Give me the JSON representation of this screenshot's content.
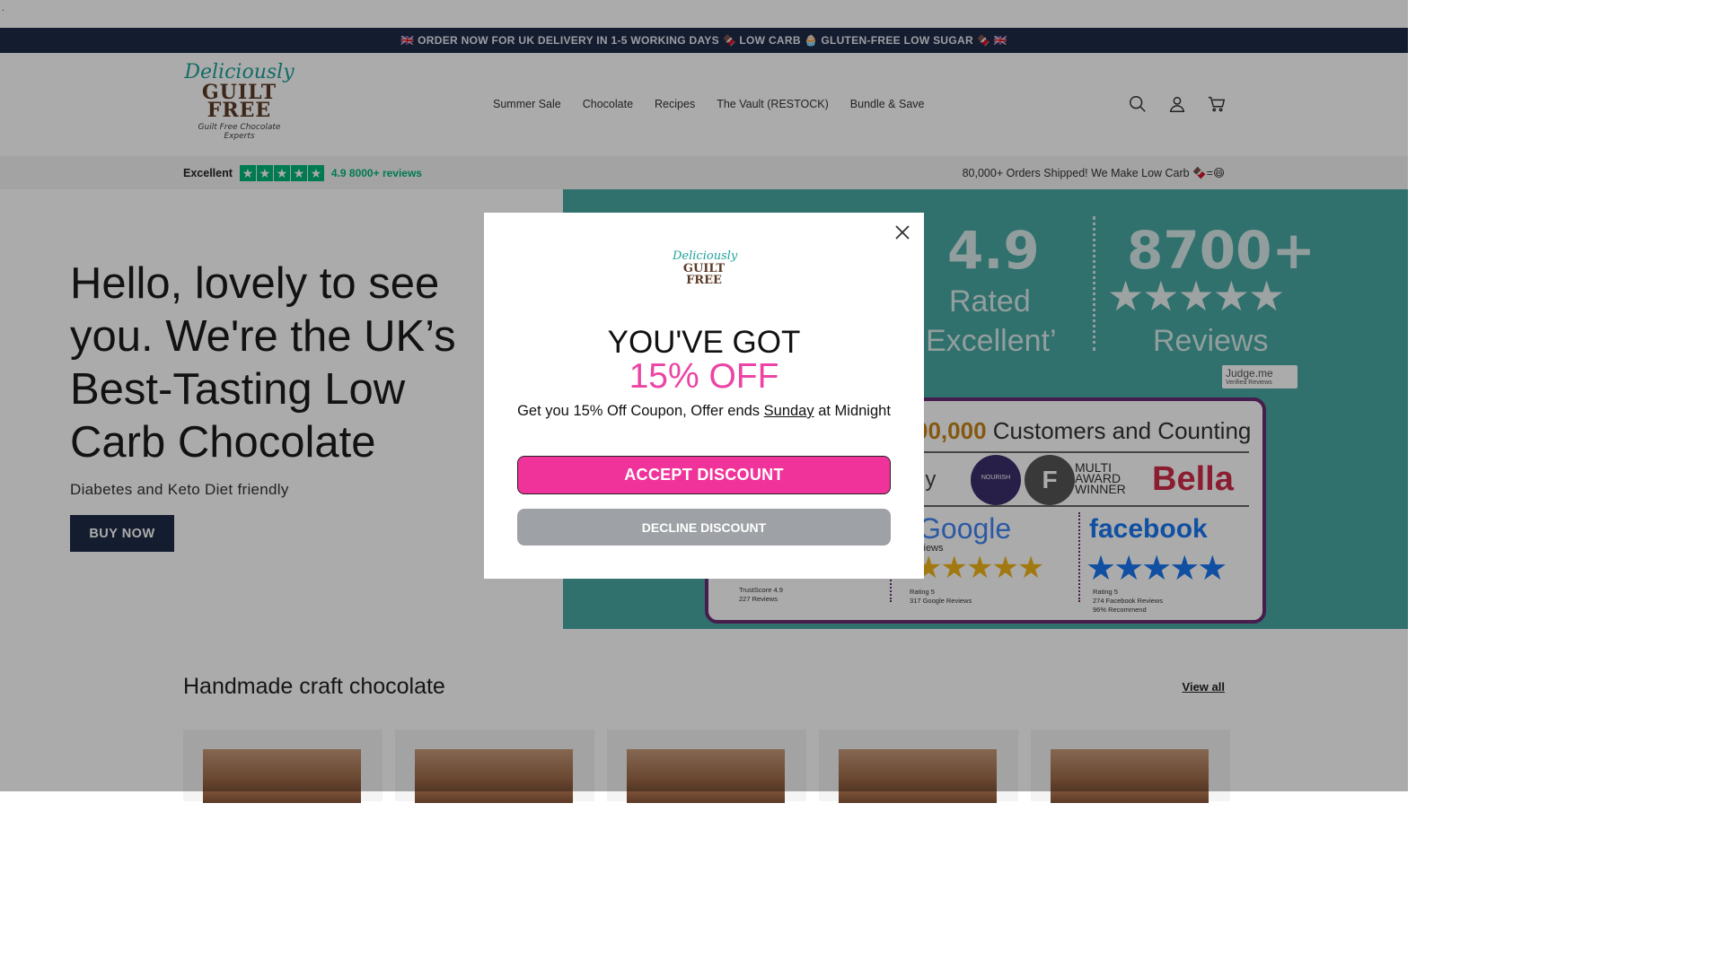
{
  "announcement": "🇬🇧 ORDER NOW FOR UK DELIVERY IN 1-5 WORKING DAYS 🍫 LOW CARB 🧁 GLUTEN-FREE LOW SUGAR 🍫 🇬🇧",
  "logo": {
    "script": "Deliciously",
    "guilt": "GUILT",
    "free": "FREE",
    "tagline": "Guilt Free Chocolate Experts"
  },
  "nav": [
    "Summer Sale",
    "Chocolate",
    "Recipes",
    "The Vault (RESTOCK)",
    "Bundle & Save"
  ],
  "header_icons": [
    "search-icon",
    "account-icon",
    "cart-icon"
  ],
  "reviews": {
    "label": "Excellent",
    "stars": 5,
    "count_text": "4.9 8000+ reviews",
    "right_text": "80,000+ Orders Shipped! We Make Low Carb 🍫=😄"
  },
  "hero": {
    "headline": "Hello, lovely to see you. We're the UK’s Best-Tasting Low Carb Chocolate",
    "subline": "Diabetes and Keto Diet friendly",
    "button": "BUY NOW"
  },
  "banner": {
    "rating": "4.9",
    "rated": "Rated",
    "excellent": "Excellent’",
    "reviews_count": "8700+",
    "reviews_label": "Reviews",
    "judgeme": "Judge.me",
    "judgeme_sub": "Verified Reviews",
    "customers_num": "00,000",
    "customers_text": "Customers and Counting",
    "ly": "ly",
    "nourish": "NOURISH",
    "multi_award": [
      "MULTI",
      "AWARD",
      "WINNER"
    ],
    "bella": "Bella",
    "google": "Google",
    "google_sub": "views",
    "facebook": "facebook",
    "trustscore": [
      "TrustScore 4.9",
      "227 Reviews"
    ],
    "google_rating": [
      "Rating  5",
      "317 Google Reviews"
    ],
    "facebook_rating": [
      "Rating  5",
      "274 Facebook Reviews",
      "96% Recommend"
    ]
  },
  "section": {
    "title": "Handmade craft chocolate",
    "view_all": "View all",
    "product_count": 5
  },
  "modal": {
    "logo_script": "Deliciously",
    "logo_guilt": "GUILT",
    "logo_free": "FREE",
    "heading": "YOU'VE GOT",
    "offer": "15% OFF",
    "message_before": "Get you 15% Off Coupon, Offer ends ",
    "message_day": "Sunday",
    "message_after": " at Midnight",
    "accept": "ACCEPT DISCOUNT",
    "decline": "DECLINE DISCOUNT"
  },
  "colors": {
    "navy": "#1f2b47",
    "teal": "#1da29a",
    "pink": "#ec44a5",
    "trustpilot_green": "#00b67a"
  }
}
